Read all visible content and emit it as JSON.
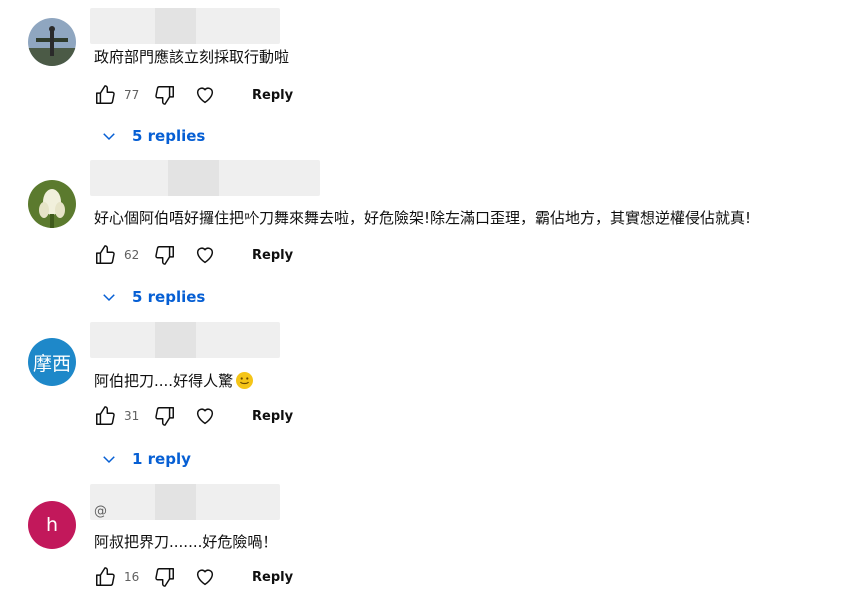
{
  "comments": [
    {
      "avatar_type": "photo",
      "avatar_colors": [
        "#5a7da8",
        "#3c4a3a"
      ],
      "text": "政府部門應該立刻採取行動啦",
      "likes": "77",
      "reply_label": "Reply",
      "replies_label": "5 replies"
    },
    {
      "avatar_type": "photo",
      "avatar_colors": [
        "#6f8f3e",
        "#e8e8d0"
      ],
      "text": "好心個阿伯唔好攞住把𠮶刀舞來舞去啦，好危險架!除左滿口歪理，霸佔地方，其實想逆權侵佔就真!",
      "likes": "62",
      "reply_label": "Reply",
      "replies_label": "5 replies"
    },
    {
      "avatar_type": "letter",
      "avatar_text": "摩西",
      "avatar_color": "#1e88c9",
      "text": "阿伯把刀....好得人驚",
      "likes": "31",
      "reply_label": "Reply",
      "replies_label": "1 reply"
    },
    {
      "avatar_type": "letter",
      "avatar_text": "h",
      "avatar_color": "#c2185b",
      "handle_prefix": "@",
      "text": "阿叔把界刀.......好危險喎！",
      "likes": "16",
      "reply_label": "Reply"
    }
  ]
}
